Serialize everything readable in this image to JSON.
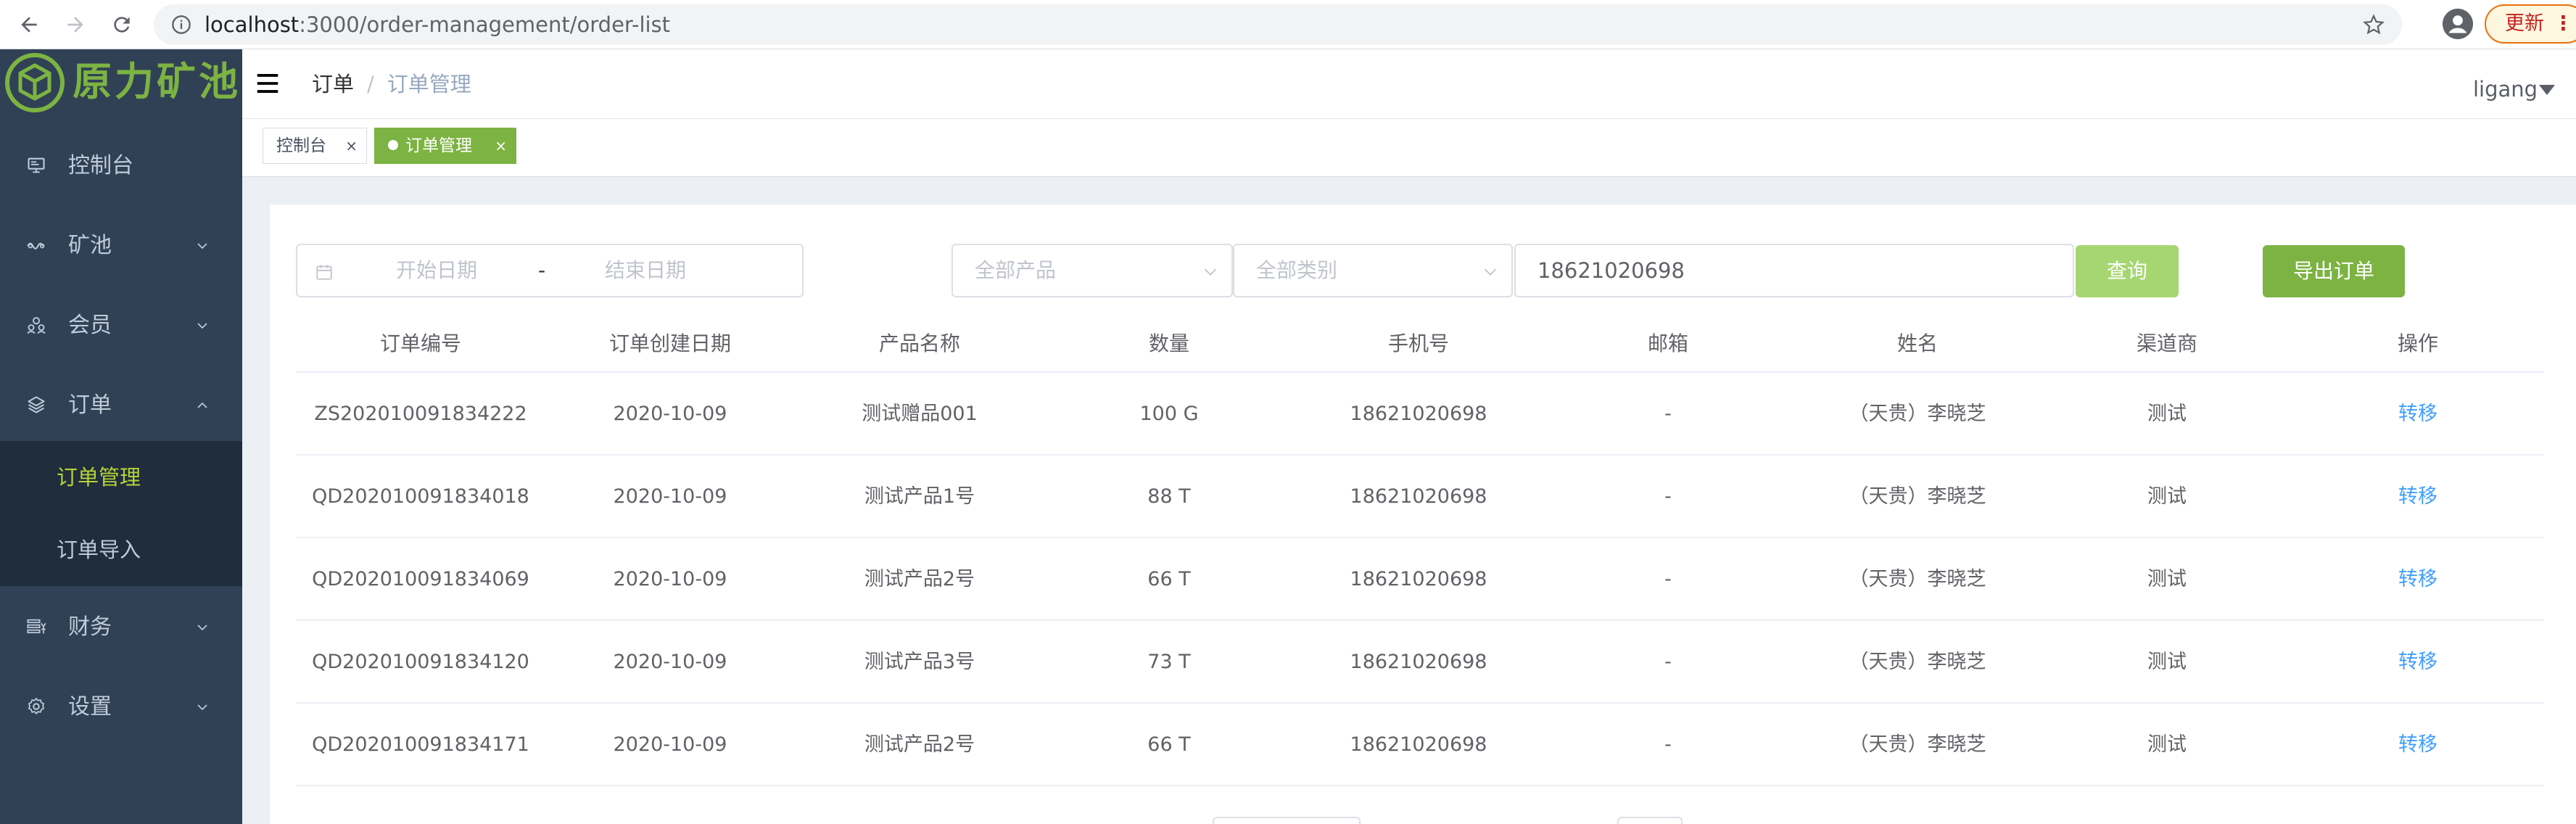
{
  "browser": {
    "url_host": "localhost",
    "url_path": ":3000/order-management/order-list",
    "update_label": "更新"
  },
  "sidebar": {
    "logo_text": "原力矿池",
    "items": [
      {
        "label": "控制台",
        "icon": "dashboard-icon",
        "expandable": false
      },
      {
        "label": "矿池",
        "icon": "pool-icon",
        "expandable": true,
        "expanded": false
      },
      {
        "label": "会员",
        "icon": "members-icon",
        "expandable": true,
        "expanded": false
      },
      {
        "label": "订单",
        "icon": "orders-icon",
        "expandable": true,
        "expanded": true
      },
      {
        "label": "财务",
        "icon": "finance-icon",
        "expandable": true,
        "expanded": false
      },
      {
        "label": "设置",
        "icon": "settings-icon",
        "expandable": true,
        "expanded": false
      }
    ],
    "subitems": [
      {
        "label": "订单管理",
        "active": true
      },
      {
        "label": "订单导入",
        "active": false
      }
    ]
  },
  "header": {
    "breadcrumb": [
      "订单",
      "订单管理"
    ],
    "breadcrumb_sep": "/",
    "user": "ligang"
  },
  "tags": [
    {
      "label": "控制台",
      "close": "×",
      "active": false
    },
    {
      "label": "订单管理",
      "close": "×",
      "active": true
    }
  ],
  "filters": {
    "start_date_placeholder": "开始日期",
    "range_separator": "-",
    "end_date_placeholder": "结束日期",
    "product_placeholder": "全部产品",
    "category_placeholder": "全部类别",
    "search_value": "18621020698",
    "query_label": "查询",
    "export_label": "导出订单"
  },
  "table": {
    "columns": [
      "订单编号",
      "订单创建日期",
      "产品名称",
      "数量",
      "手机号",
      "邮箱",
      "姓名",
      "渠道商",
      "操作"
    ],
    "rows": [
      [
        "ZS202010091834222",
        "2020-10-09",
        "测试赠品001",
        "100 G",
        "18621020698",
        "-",
        "（天贵）李晓芝",
        "测试",
        "转移"
      ],
      [
        "QD202010091834018",
        "2020-10-09",
        "测试产品1号",
        "88 T",
        "18621020698",
        "-",
        "（天贵）李晓芝",
        "测试",
        "转移"
      ],
      [
        "QD202010091834069",
        "2020-10-09",
        "测试产品2号",
        "66 T",
        "18621020698",
        "-",
        "（天贵）李晓芝",
        "测试",
        "转移"
      ],
      [
        "QD202010091834120",
        "2020-10-09",
        "测试产品3号",
        "73 T",
        "18621020698",
        "-",
        "（天贵）李晓芝",
        "测试",
        "转移"
      ],
      [
        "QD202010091834171",
        "2020-10-09",
        "测试产品2号",
        "66 T",
        "18621020698",
        "-",
        "（天贵）李晓芝",
        "测试",
        "转移"
      ]
    ]
  },
  "colors": {
    "sidebar_bg": "#304156",
    "submenu_bg": "#1f2d3d",
    "brand_green": "#7cb342",
    "active_sub": "#b5d336",
    "link_blue": "#409eff"
  }
}
